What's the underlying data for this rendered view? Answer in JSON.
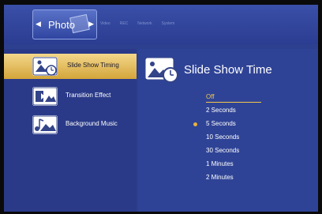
{
  "header": {
    "tab_label": "Photo",
    "menu_tabs": [
      "Video",
      "REC",
      "Network",
      "System"
    ]
  },
  "sidebar": {
    "items": [
      {
        "label": "Slide Show Timing",
        "selected": true,
        "icon": "slideshow-clock-icon"
      },
      {
        "label": "Transition Effect",
        "selected": false,
        "icon": "transition-icon"
      },
      {
        "label": "Background Music",
        "selected": false,
        "icon": "music-icon"
      }
    ]
  },
  "panel": {
    "title": "Slide Show Time",
    "icon": "slideshow-clock-icon",
    "options": [
      "Off",
      "2 Seconds",
      "5 Seconds",
      "10 Seconds",
      "30 Seconds",
      "1 Minutes",
      "2 Minutes"
    ],
    "highlighted": "Off",
    "current": "5 Seconds"
  },
  "colors": {
    "background": "#2d3f8f",
    "selected_gold": "#f2c84a",
    "highlight_bar": "#d4a53a"
  }
}
